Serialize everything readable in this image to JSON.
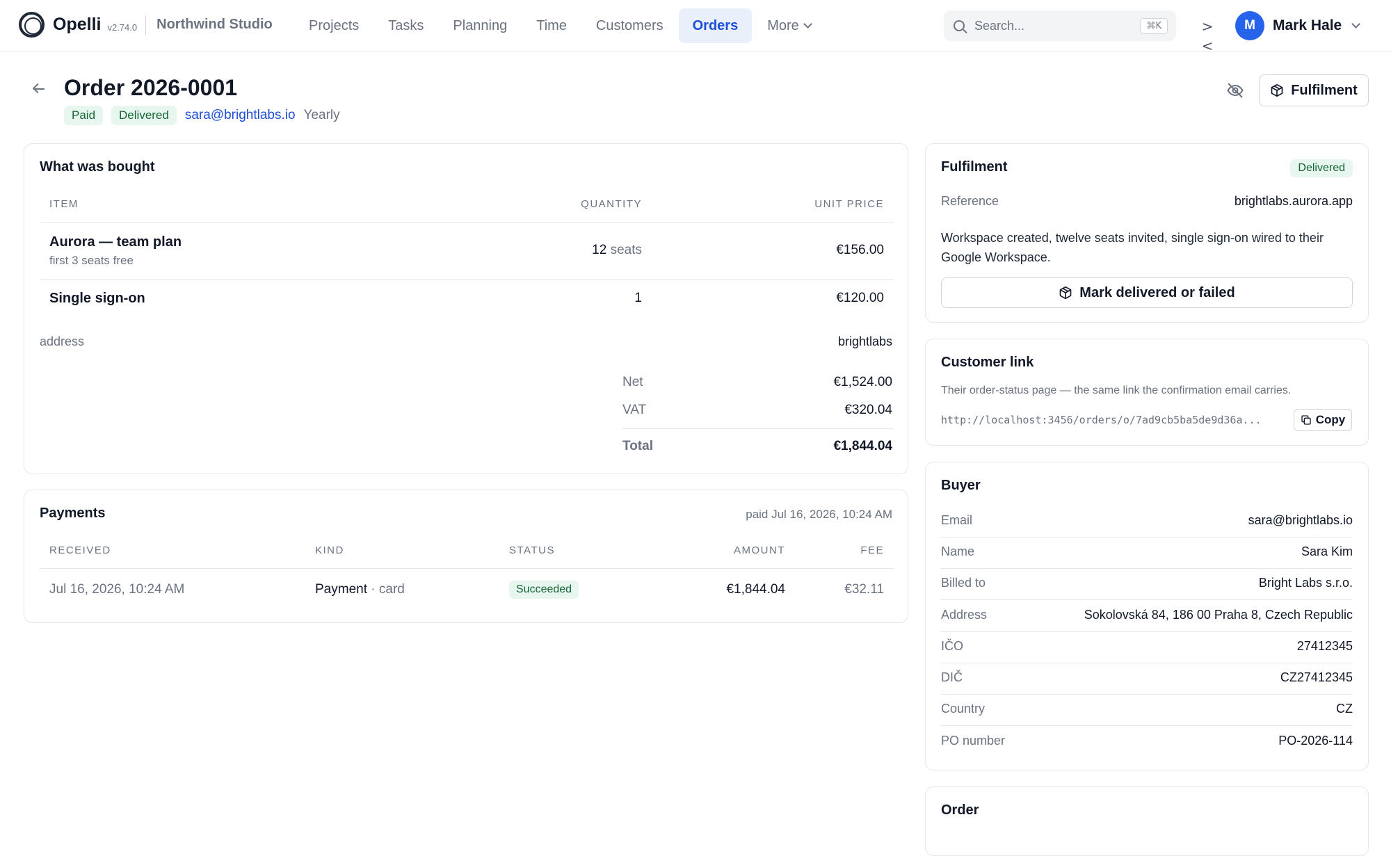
{
  "app": {
    "name": "Opelli",
    "version": "v2.74.0",
    "workspace": "Northwind Studio"
  },
  "nav": {
    "items": [
      {
        "label": "Projects"
      },
      {
        "label": "Tasks"
      },
      {
        "label": "Planning"
      },
      {
        "label": "Time"
      },
      {
        "label": "Customers"
      },
      {
        "label": "Orders",
        "active": true
      }
    ],
    "more_label": "More"
  },
  "search": {
    "placeholder": "Search...",
    "shortcut": "⌘K"
  },
  "collapse_glyph": "><",
  "user": {
    "initial": "M",
    "name": "Mark Hale"
  },
  "order": {
    "title": "Order 2026-0001",
    "badges": [
      "Paid",
      "Delivered"
    ],
    "email": "sara@brightlabs.io",
    "cycle": "Yearly",
    "fulfilment_button": "Fulfilment"
  },
  "bought": {
    "title": "What was bought",
    "columns": {
      "item": "ITEM",
      "quantity": "QUANTITY",
      "unit_price": "UNIT PRICE"
    },
    "rows": [
      {
        "name": "Aurora — team plan",
        "note": "first 3 seats free",
        "qty": "12",
        "qty_unit": "seats",
        "price": "€156.00"
      },
      {
        "name": "Single sign-on",
        "note": "",
        "qty": "1",
        "qty_unit": "",
        "price": "€120.00"
      }
    ],
    "address_label": "address",
    "address_value": "brightlabs",
    "net_label": "Net",
    "net_value": "€1,524.00",
    "vat_label": "VAT",
    "vat_value": "€320.04",
    "total_label": "Total",
    "total_value": "€1,844.04"
  },
  "payments": {
    "title": "Payments",
    "paid_at": "paid Jul 16, 2026, 10:24 AM",
    "columns": {
      "received": "RECEIVED",
      "kind": "KIND",
      "status": "STATUS",
      "amount": "AMOUNT",
      "fee": "FEE"
    },
    "rows": [
      {
        "received": "Jul 16, 2026, 10:24 AM",
        "kind": "Payment",
        "kind_detail": "· card",
        "status": "Succeeded",
        "amount": "€1,844.04",
        "fee": "€32.11"
      }
    ]
  },
  "fulfilment": {
    "title": "Fulfilment",
    "status": "Delivered",
    "reference_label": "Reference",
    "reference_value": "brightlabs.aurora.app",
    "description": "Workspace created, twelve seats invited, single sign-on wired to their Google Workspace.",
    "action_button": "Mark delivered or failed"
  },
  "customer_link": {
    "title": "Customer link",
    "description": "Their order-status page — the same link the confirmation email carries.",
    "url": "http://localhost:3456/orders/o/7ad9cb5ba5de9d36a...",
    "copy_label": "Copy"
  },
  "buyer": {
    "title": "Buyer",
    "fields": [
      {
        "label": "Email",
        "value": "sara@brightlabs.io"
      },
      {
        "label": "Name",
        "value": "Sara Kim"
      },
      {
        "label": "Billed to",
        "value": "Bright Labs s.r.o."
      },
      {
        "label": "Address",
        "value": "Sokolovská 84, 186 00 Praha 8, Czech Republic"
      },
      {
        "label": "IČO",
        "value": "27412345"
      },
      {
        "label": "DIČ",
        "value": "CZ27412345"
      },
      {
        "label": "Country",
        "value": "CZ"
      },
      {
        "label": "PO number",
        "value": "PO-2026-114"
      }
    ]
  },
  "order_card": {
    "title": "Order"
  },
  "colors": {
    "accent": "#1d4ed8",
    "success_bg": "#e7f6ee",
    "success_text": "#166534",
    "avatar": "#2563eb"
  },
  "icons": [
    "app-logo-icon",
    "chevron-down-icon",
    "search-icon",
    "collapse-icon",
    "back-arrow-icon",
    "eye-off-icon",
    "package-icon",
    "copy-icon"
  ]
}
